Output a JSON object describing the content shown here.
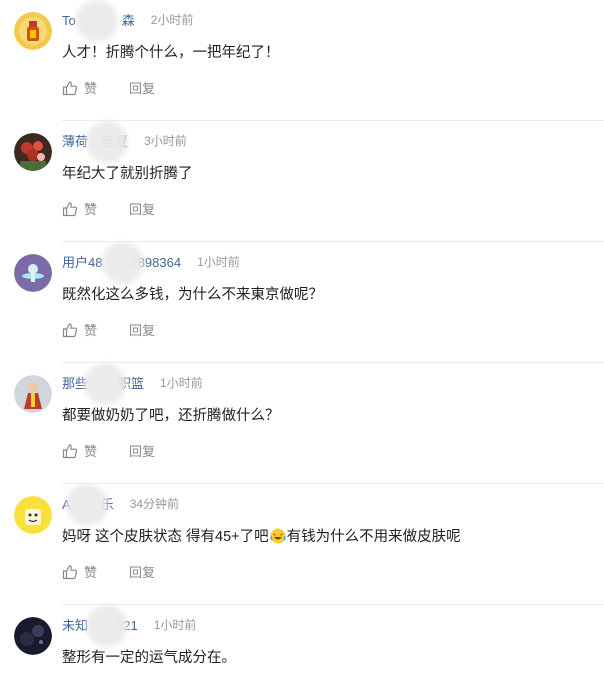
{
  "actions": {
    "like_label": "赞",
    "reply_label": "回复"
  },
  "comments": [
    {
      "user_pre": "To",
      "user_post": "森",
      "time": "2小时前",
      "text": "人才！折腾个什么，一把年纪了！",
      "avatar": "avatar-yellow-figure"
    },
    {
      "user_pre": "薄荷",
      "user_post": "盛夏",
      "time": "3小时前",
      "text": "年纪大了就别折腾了",
      "avatar": "avatar-red-flowers"
    },
    {
      "user_pre": "用户48",
      "user_post": "1898364",
      "time": "1小时前",
      "text": "既然化这么多钱，为什么不来東京做呢？",
      "avatar": "avatar-purple-default"
    },
    {
      "user_pre": "那些",
      "user_post": "职篮",
      "time": "1小时前",
      "text": "都要做奶奶了吧，还折腾做什么？",
      "avatar": "avatar-red-character"
    },
    {
      "user_pre": "A",
      "user_post": "乐",
      "time": "34分钟前",
      "text_a": "妈呀 这个皮肤状态 得有45+了吧",
      "text_b": "有钱为什么不用来做皮肤呢",
      "emoji": "laughing-crying-emoji",
      "avatar": "avatar-yellow-cartoon"
    },
    {
      "user_pre": "未知",
      "user_post": "321",
      "time": "1小时前",
      "text": "整形有一定的运气成分在。",
      "avatar": "avatar-dark-night"
    }
  ]
}
